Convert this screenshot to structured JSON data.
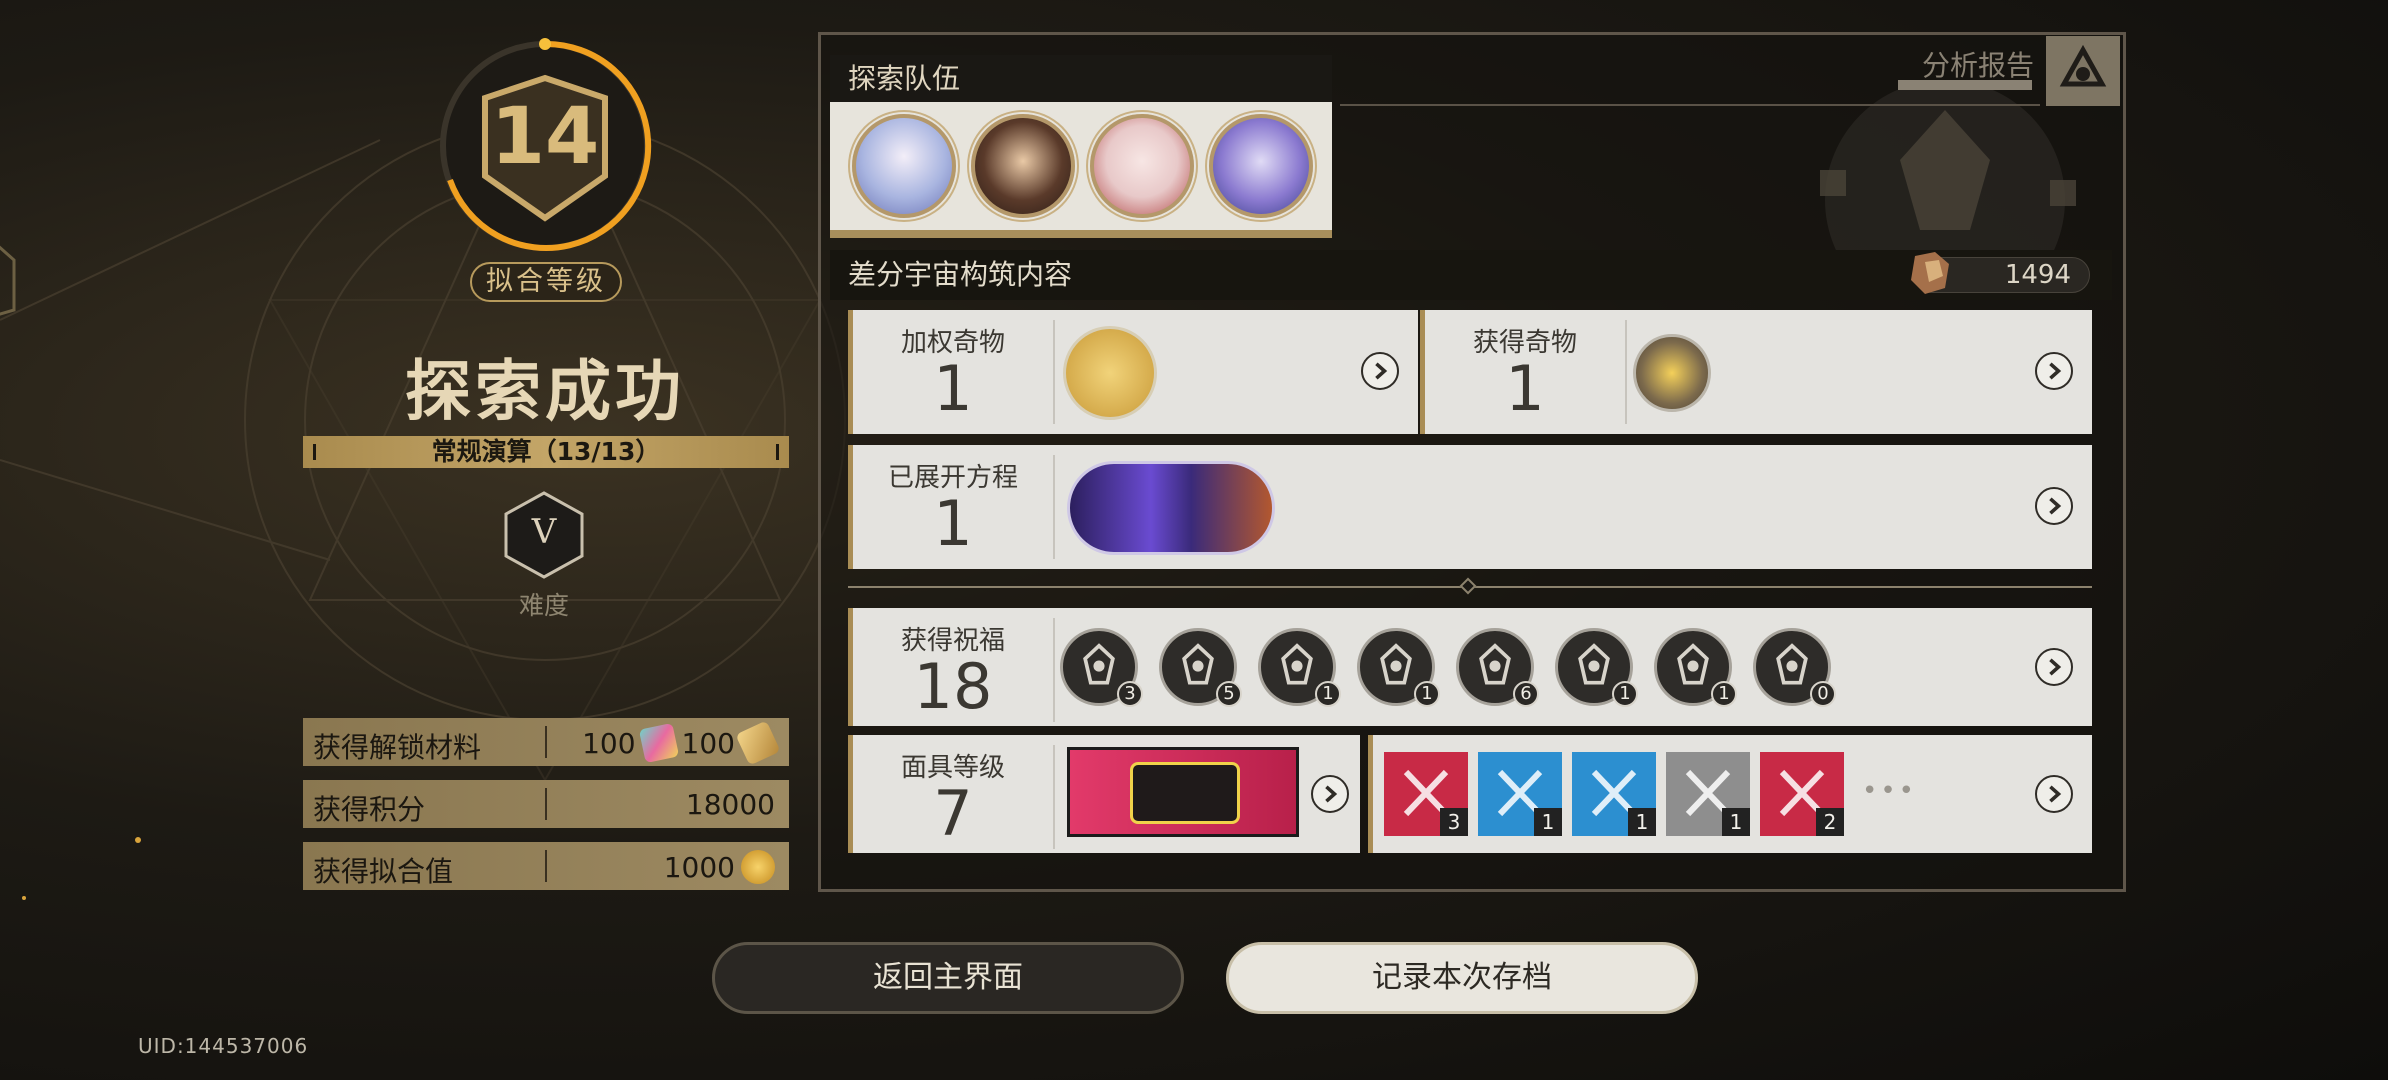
{
  "left_panel": {
    "fit_level_value": "14",
    "fit_level_label": "拟合等级",
    "result_title": "探索成功",
    "mode": "常规演算（13/13）",
    "difficulty_letter": "V",
    "difficulty_label": "难度",
    "stats": [
      {
        "label": "获得解锁材料",
        "value_a": "100",
        "value_b": "100",
        "icons": [
          "card-pack-icon",
          "ticket-icon"
        ]
      },
      {
        "label": "获得积分",
        "value": "18000"
      },
      {
        "label": "获得拟合值",
        "value": "1000",
        "icon": "fit-value-coin-icon"
      }
    ]
  },
  "team": {
    "title": "探索队伍",
    "members": [
      "member-1",
      "member-2",
      "member-3",
      "member-4"
    ]
  },
  "report": {
    "label": "分析报告"
  },
  "content": {
    "title": "差分宇宙构筑内容",
    "credit": "1494",
    "weighted_curio": {
      "label": "加权奇物",
      "count": "1"
    },
    "obtained_curio": {
      "label": "获得奇物",
      "count": "1"
    },
    "equations": {
      "label": "已展开方程",
      "count": "1"
    },
    "blessings": {
      "label": "获得祝福",
      "count": "18",
      "items": [
        {
          "icon": "path-destruction-icon",
          "count": "3"
        },
        {
          "icon": "path-preservation-icon",
          "count": "5"
        },
        {
          "icon": "path-nihility-icon",
          "count": "1"
        },
        {
          "icon": "path-abundance-icon",
          "count": "1"
        },
        {
          "icon": "path-erudition-icon",
          "count": "6"
        },
        {
          "icon": "path-propagation-icon",
          "count": "1"
        },
        {
          "icon": "path-remembrance-icon",
          "count": "1"
        },
        {
          "icon": "path-elation-icon",
          "count": "0"
        }
      ]
    },
    "mask": {
      "label": "面具等级",
      "level": "7",
      "items": [
        {
          "icon": "crossed-swords-icon",
          "count": "3",
          "color": "#c82a46"
        },
        {
          "icon": "question-icon",
          "count": "1",
          "color": "#2c8fd0"
        },
        {
          "icon": "gamepad-icon",
          "count": "1",
          "color": "#2c8fd0"
        },
        {
          "icon": "slash-icon",
          "count": "1",
          "color": "#8e8e8e"
        },
        {
          "icon": "sword-icon",
          "count": "2",
          "color": "#c82a46"
        }
      ],
      "more": "•••"
    }
  },
  "buttons": {
    "back": "返回主界面",
    "save": "记录本次存档"
  },
  "uid": "UID:144537006",
  "colors": {
    "gold": "#c9a96a",
    "panel_light": "#e4e3df",
    "ring_orange": "#f0a020"
  }
}
